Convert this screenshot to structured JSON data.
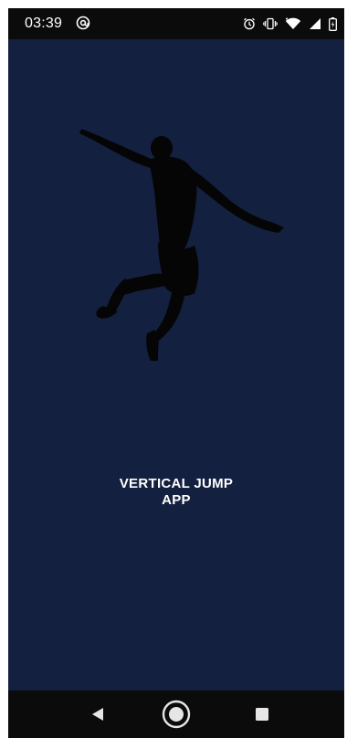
{
  "status_bar": {
    "time": "03:39",
    "left_icon": "at-sign-notification-icon",
    "right_icons": [
      "alarm-icon",
      "vibrate-icon",
      "wifi-icon",
      "signal-icon",
      "battery-icon"
    ]
  },
  "splash": {
    "hero_image": "jumping-athlete-silhouette",
    "title_line1": "VERTICAL JUMP",
    "title_line2": "APP",
    "background_color": "#142040"
  },
  "nav_bar": {
    "buttons": [
      "back-icon",
      "home-icon",
      "recents-icon"
    ]
  }
}
